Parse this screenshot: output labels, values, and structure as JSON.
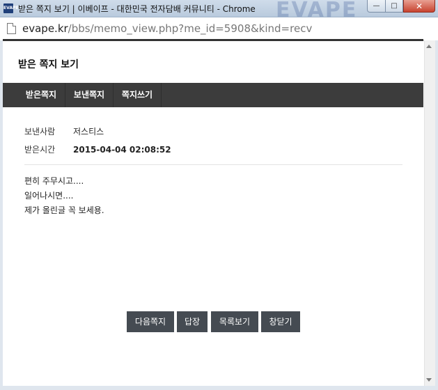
{
  "window": {
    "app_icon_text": "EVAPE",
    "title": "받은 쪽지 보기 | 이베이프 - 대한민국 전자담배 커뮤니티 - Chrome",
    "bg_deco_text": "EVAPE",
    "minimize_glyph": "—",
    "maximize_glyph": "□",
    "close_glyph": "✕"
  },
  "address": {
    "domain": "evape.kr",
    "path": "/bbs/memo_view.php?me_id=5908&kind=recv"
  },
  "page": {
    "heading": "받은 쪽지 보기"
  },
  "tabs": [
    {
      "label": "받은쪽지"
    },
    {
      "label": "보낸쪽지"
    },
    {
      "label": "쪽지쓰기"
    }
  ],
  "memo": {
    "sender_label": "보낸사람",
    "sender": "저스티스",
    "time_label": "받은시간",
    "time": "2015-04-04 02:08:52",
    "lines": [
      "편히 주무시고....",
      "일어나시면....",
      "제가 올린글 꼭 보세용."
    ]
  },
  "buttons": {
    "next": "다음쪽지",
    "reply": "답장",
    "list": "목록보기",
    "close": "창닫기"
  },
  "colors": {
    "nav_bg": "#3c3c3c",
    "button_bg": "#454b52",
    "top_line": "#333333"
  }
}
